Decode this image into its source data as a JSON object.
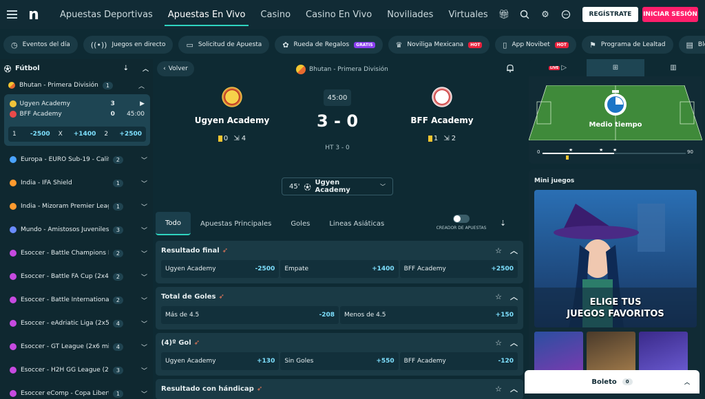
{
  "nav": {
    "tabs": [
      "Apuestas Deportivas",
      "Apuestas En Vivo",
      "Casino",
      "Casino En Vivo",
      "Noviliades",
      "Virtuales"
    ],
    "register": "REGÍSTRATE",
    "login": "INICIAR SESIÓN"
  },
  "pills": [
    {
      "icon": "clock-icon",
      "label": "Eventos del día"
    },
    {
      "icon": "live-icon",
      "label": "Juegos en directo"
    },
    {
      "icon": "ticket-icon",
      "label": "Solicitud de Apuesta"
    },
    {
      "icon": "gift-icon",
      "label": "Rueda de Regalos",
      "badge": "GRATIS"
    },
    {
      "icon": "trophy-icon",
      "label": "Noviliga Mexicana",
      "badge": "HOT"
    },
    {
      "icon": "phone-icon",
      "label": "App Novibet",
      "badge": "HOT"
    },
    {
      "icon": "loyalty-icon",
      "label": "Programa de Lealtad"
    },
    {
      "icon": "blog-icon",
      "label": "Blog"
    }
  ],
  "sidebar": {
    "sport": "Fútbol",
    "league": {
      "name": "Bhutan - Primera División",
      "count": "1"
    },
    "match": {
      "home": "Ugyen Academy",
      "home_score": "3",
      "away": "BFF Academy",
      "away_score": "0",
      "time": "45:00",
      "odds": [
        {
          "label": "1",
          "value": "-2500"
        },
        {
          "label": "X",
          "value": "+1400"
        },
        {
          "label": "2",
          "value": "+2500"
        }
      ]
    },
    "items": [
      {
        "name": "Europa - EURO Sub-19 - Calific...",
        "count": "2",
        "color": "#4aa3ff"
      },
      {
        "name": "India - IFA Shield",
        "count": "1",
        "color": "#ff9a2e"
      },
      {
        "name": "India - Mizoram Premier Leag...",
        "count": "1",
        "color": "#ff9a2e"
      },
      {
        "name": "Mundo - Amistosos Juveniles I...",
        "count": "3",
        "color": "#6a8cff"
      },
      {
        "name": "Esoccer - Battle Champions L...",
        "count": "2",
        "color": "#c64ae0"
      },
      {
        "name": "Esoccer - Battle FA Cup (2x4 ...",
        "count": "2",
        "color": "#c64ae0"
      },
      {
        "name": "Esoccer - Battle International ...",
        "count": "2",
        "color": "#c64ae0"
      },
      {
        "name": "Esoccer - eAdriatic Liga (2x5 ...",
        "count": "4",
        "color": "#c64ae0"
      },
      {
        "name": "Esoccer - GT League (2x6 min...",
        "count": "4",
        "color": "#c64ae0"
      },
      {
        "name": "Esoccer - H2H GG League (2x4...",
        "count": "3",
        "color": "#c64ae0"
      },
      {
        "name": "Esoccer eComp - Copa Liberta...",
        "count": "1",
        "color": "#c64ae0"
      }
    ]
  },
  "event": {
    "back": "Volver",
    "league": "Bhutan - Primera División",
    "home": {
      "name": "Ugyen Academy",
      "cards": "0",
      "corners": "4"
    },
    "away": {
      "name": "BFF Academy",
      "cards": "1",
      "corners": "2"
    },
    "clock": "45:00",
    "score": "3 - 0",
    "halftime": "HT 3 - 0",
    "selector": {
      "minute": "45'",
      "team": "Ugyen Academy"
    }
  },
  "market_tabs": [
    "Todo",
    "Apuestas Principales",
    "Goles",
    "Lineas Asiáticas"
  ],
  "bet_builder": "CREADOR DE APUESTAS",
  "markets": [
    {
      "title": "Resultado final",
      "cells": [
        [
          "Ugyen Academy",
          "-2500"
        ],
        [
          "Empate",
          "+1400"
        ],
        [
          "BFF Academy",
          "+2500"
        ]
      ]
    },
    {
      "title": "Total de Goles",
      "cells": [
        [
          "Más de 4.5",
          "-208"
        ],
        [
          "Menos de 4.5",
          "+150"
        ]
      ]
    },
    {
      "title": "(4)º Gol",
      "cells": [
        [
          "Ugyen Academy",
          "+130"
        ],
        [
          "Sin Goles",
          "+550"
        ],
        [
          "BFF Academy",
          "-120"
        ]
      ]
    },
    {
      "title": "Resultado con hándicap",
      "cells": []
    }
  ],
  "right": {
    "live": "LIVE",
    "pitch_label": "Medio tiempo",
    "timeline_start": "0",
    "timeline_end": "90",
    "mini_title": "Mini juegos",
    "hero_text_1": "ELIGE TUS",
    "hero_text_2": "JUEGOS FAVORITOS"
  },
  "boleto": {
    "label": "Boleto",
    "count": "0"
  }
}
